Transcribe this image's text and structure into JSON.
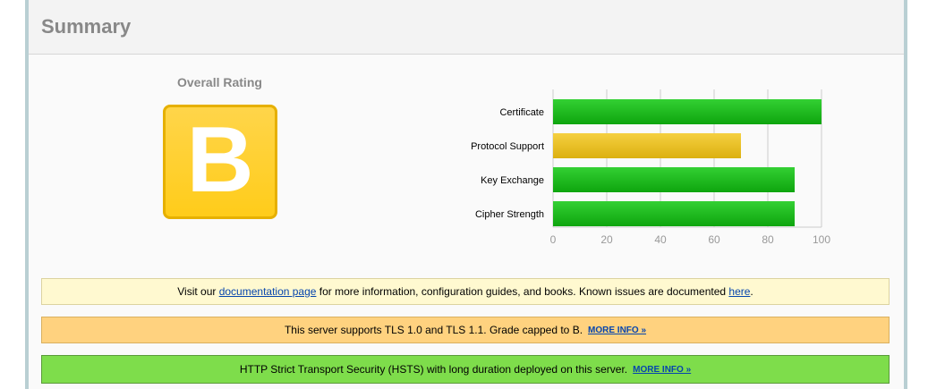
{
  "summary": {
    "title": "Summary",
    "overall_rating_label": "Overall Rating",
    "grade": "B",
    "grade_color": "#ffcc1a"
  },
  "chart_data": {
    "type": "bar",
    "orientation": "horizontal",
    "categories": [
      "Certificate",
      "Protocol Support",
      "Key Exchange",
      "Cipher Strength"
    ],
    "values": [
      100,
      70,
      90,
      90
    ],
    "colors": [
      "#22bb22",
      "#e6bf1a",
      "#22bb22",
      "#22bb22"
    ],
    "xlim": [
      0,
      100
    ],
    "xticks": [
      "0",
      "20",
      "40",
      "60",
      "80",
      "100"
    ],
    "grid": true,
    "title": "",
    "xlabel": "",
    "ylabel": ""
  },
  "notices": {
    "info": {
      "prefix": "Visit our ",
      "link1": "documentation page",
      "middle": " for more information, configuration guides, and books. Known issues are documented ",
      "link2": "here",
      "suffix": "."
    },
    "warning": {
      "text": "This server supports TLS 1.0 and TLS 1.1. Grade capped to B.",
      "link": "MORE INFO »"
    },
    "good": {
      "text": "HTTP Strict Transport Security (HSTS) with long duration deployed on this server.",
      "link": "MORE INFO »"
    }
  }
}
